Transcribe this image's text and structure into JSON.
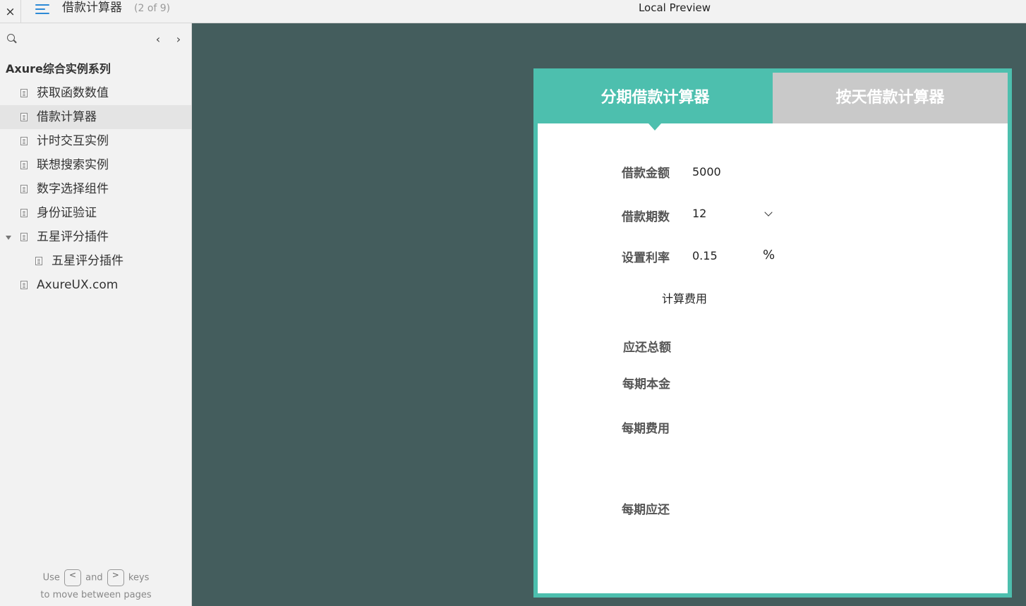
{
  "topbar": {
    "close_glyph": "×",
    "page_title": "借款计算器",
    "page_count": "(2 of 9)",
    "preview_title": "Local Preview"
  },
  "sidebar": {
    "prev_glyph": "‹",
    "next_glyph": "›",
    "folder_title": "Axure综合实例系列",
    "items": [
      {
        "label": "获取函数数值",
        "selected": false
      },
      {
        "label": "借款计算器",
        "selected": true
      },
      {
        "label": "计时交互实例",
        "selected": false
      },
      {
        "label": "联想搜索实例",
        "selected": false
      },
      {
        "label": "数字选择组件",
        "selected": false
      },
      {
        "label": "身份证验证",
        "selected": false
      },
      {
        "label": "五星评分插件",
        "selected": false,
        "expanded": true
      },
      {
        "label": "五星评分插件",
        "selected": false,
        "child": true
      },
      {
        "label": "AxureUX.com",
        "selected": false
      }
    ],
    "hint": {
      "use": "Use",
      "and": "and",
      "keys": "keys",
      "line2": "to move between pages",
      "key_prev": "<",
      "key_next": ">"
    }
  },
  "calculator": {
    "tab_active": "分期借款计算器",
    "tab_inactive": "按天借款计算器",
    "loan_amount_label": "借款金额",
    "loan_amount_value": "5000",
    "loan_term_label": "借款期数",
    "loan_term_value": "12",
    "rate_label": "设置利率",
    "rate_value": "0.15",
    "rate_unit": "%",
    "calc_button": "计算费用",
    "total_label": "应还总额",
    "principal_label": "每期本金",
    "fee_label": "每期费用",
    "payment_label": "每期应还"
  },
  "colors": {
    "accent": "#4dbfae",
    "canvas_bg": "#445d5d",
    "tab_inactive": "#c9c9c9"
  }
}
